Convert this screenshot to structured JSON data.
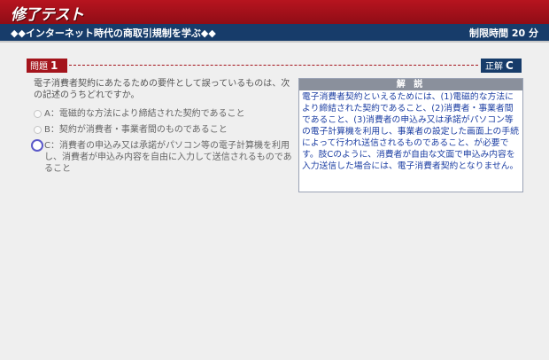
{
  "header": {
    "title": "修了テスト"
  },
  "subheader": {
    "course_title": "◆◆インターネット時代の商取引規制を学ぶ◆◆",
    "time_limit": "制限時間 20 分"
  },
  "question": {
    "badge_label": "問題",
    "number": "1",
    "answer_label": "正解",
    "answer_value": "C",
    "text": "電子消費者契約にあたるための要件として誤っているものは、次の記述のうちどれですか。",
    "choices": [
      {
        "label": "A：電磁的な方法により締結された契約であること",
        "selected": false
      },
      {
        "label": "B：契約が消費者・事業者間のものであること",
        "selected": false
      },
      {
        "label": "C：消費者の申込み又は承諾がパソコン等の電子計算機を利用し、消費者が申込み内容を自由に入力して送信されるものであること",
        "selected": true
      }
    ]
  },
  "explanation": {
    "heading": "解 説",
    "body": "電子消費者契約といえるためには、(1)電磁的な方法により締結された契約であること、(2)消費者・事業者間であること、(3)消費者の申込み又は承諾がパソコン等の電子計算機を利用し、事業者の設定した画面上の手続によって行われ送信されるものであること、が必要です。肢Cのように、消費者が自由な文面で申込み内容を入力送信した場合には、電子消費者契約となりません。"
  },
  "colors": {
    "header_red": "#a4141c",
    "navy": "#173c6a",
    "explanation_text": "#1d3fa3",
    "selected_radio": "#5b59c9"
  }
}
